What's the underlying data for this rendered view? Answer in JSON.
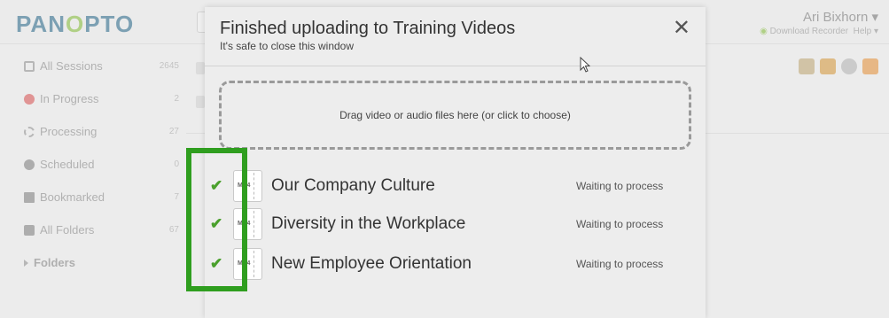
{
  "app": {
    "logo_left": "PAN",
    "logo_o": "O",
    "logo_right": "PTO",
    "user_name": "Ari Bixhorn ▾",
    "download_recorder": "Download Recorder",
    "help": "Help ▾"
  },
  "sidebar": {
    "items": [
      {
        "label": "All Sessions",
        "count": "2645",
        "icon": "sessions-icon"
      },
      {
        "label": "In Progress",
        "count": "2",
        "icon": "recording-dot-icon"
      },
      {
        "label": "Processing",
        "count": "27",
        "icon": "processing-icon"
      },
      {
        "label": "Scheduled",
        "count": "0",
        "icon": "clock-icon"
      },
      {
        "label": "Bookmarked",
        "count": "7",
        "icon": "bookmark-icon"
      },
      {
        "label": "All Folders",
        "count": "67",
        "icon": "folder-icon"
      },
      {
        "label": "Folders",
        "count": "",
        "icon": "expand-arrow-icon"
      }
    ]
  },
  "modal": {
    "title": "Finished uploading to Training Videos",
    "subtitle": "It's safe to close this window",
    "close": "✕",
    "dropzone_text": "Drag video or audio files here (or click to choose)",
    "files": [
      {
        "check": "✔",
        "type": "MP4",
        "name": "Our Company Culture",
        "status": "Waiting to process"
      },
      {
        "check": "✔",
        "type": "MP4",
        "name": "Diversity in the Workplace",
        "status": "Waiting to process"
      },
      {
        "check": "✔",
        "type": "MP4",
        "name": "New Employee Orientation",
        "status": "Waiting to process"
      }
    ]
  },
  "colors": {
    "accent_green": "#2f9e1f",
    "check_green": "#4aa02c",
    "logo_blue": "#2f6f93"
  }
}
